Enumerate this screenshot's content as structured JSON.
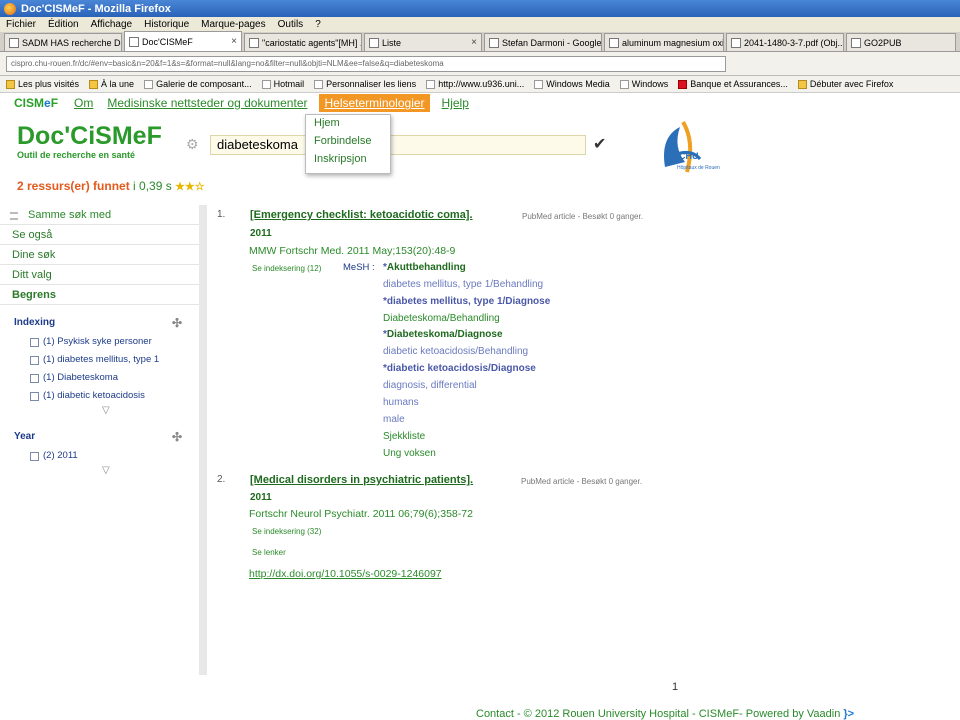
{
  "window": {
    "title": "Doc'CISMeF - Mozilla Firefox"
  },
  "menu": [
    "Fichier",
    "Édition",
    "Affichage",
    "Historique",
    "Marque-pages",
    "Outils",
    "?"
  ],
  "tabs": [
    {
      "label": "SADM HAS recherche Do...",
      "close": "×"
    },
    {
      "label": "Doc'CISMeF",
      "close": "×"
    },
    {
      "label": "\"cariostatic agents\"[MH] ...",
      "close": "×"
    },
    {
      "label": "Liste",
      "close": "×"
    },
    {
      "label": "Stefan Darmoni - Google ...",
      "close": "×"
    },
    {
      "label": "aluminum magnesium oxide",
      "close": "×"
    },
    {
      "label": "2041-1480-3-7.pdf (Obj...",
      "close": "×"
    },
    {
      "label": "GO2PUB",
      "close": ""
    }
  ],
  "url": "cispro.chu-rouen.fr/dc/#env=basic&n=20&f=1&s=&format=null&lang=no&filter=null&objti=NLM&ee=false&q=diabeteskoma",
  "bookmarks": [
    "Les plus visités",
    "À la une",
    "Galerie de composant...",
    "Hotmail",
    "Personnaliser les liens",
    "http://www.u936.uni...",
    "Windows Media",
    "Windows",
    "Banque et Assurances...",
    "Débuter avec Firefox"
  ],
  "nav": {
    "brand_a": "CISM",
    "brand_e": "e",
    "brand_b": "F",
    "items": [
      "Om",
      "Medisinske nettsteder og dokumenter",
      "Helseterminologier",
      "Hjelp"
    ],
    "dropdown": [
      "Hjem",
      "Forbindelse",
      "Inskripsjon"
    ]
  },
  "logo": {
    "title": "Doc'CiSMeF",
    "subtitle": "Outil de recherche en santé"
  },
  "chu": {
    "label": "CHU",
    "sub": "Hôpitaux de Rouen"
  },
  "search": {
    "value": "diabeteskoma",
    "submit": "✔"
  },
  "results_summary": {
    "count_text": "2 ressurs(er) funnet",
    "time_text": " i 0,39 s ",
    "stars": "★★☆"
  },
  "sidebar": {
    "sections": [
      "Samme søk med",
      "Se også",
      "Dine søk",
      "Ditt valg",
      "Begrens"
    ],
    "facets": [
      {
        "title": "Indexing",
        "items": [
          "(1) Psykisk syke personer",
          "(1) diabetes mellitus, type 1",
          "(1) Diabeteskoma",
          "(1) diabetic ketoacidosis"
        ]
      },
      {
        "title": "Year",
        "items": [
          "(2) 2011"
        ]
      }
    ],
    "move_icon": "✣",
    "more_icon": "▽"
  },
  "results": [
    {
      "num": "1.",
      "title": "[Emergency checklist: ketoacidotic coma].",
      "meta": "PubMed article - Besøkt 0 ganger.",
      "year": "2011",
      "source": "MMW Fortschr Med. 2011 May;153(20):48-9",
      "indexing_link": "Se indeksering (12)",
      "mesh_label": "MeSH :",
      "mesh_terms": [
        {
          "star": "*",
          "text": "Akuttbehandling"
        },
        {
          "star": "",
          "text": "diabetes mellitus, type 1/Behandling"
        },
        {
          "star": "*",
          "text": "diabetes mellitus, type 1/Diagnose"
        },
        {
          "star": "",
          "text": "Diabeteskoma/Behandling"
        },
        {
          "star": "*",
          "text": "Diabeteskoma/Diagnose"
        },
        {
          "star": "",
          "text": "diabetic ketoacidosis/Behandling"
        },
        {
          "star": "*",
          "text": "diabetic ketoacidosis/Diagnose"
        },
        {
          "star": "",
          "text": "diagnosis, differential"
        },
        {
          "star": "",
          "text": "humans"
        },
        {
          "star": "",
          "text": "male"
        },
        {
          "star": "",
          "text": "Sjekkliste"
        },
        {
          "star": "",
          "text": "Ung voksen"
        }
      ]
    },
    {
      "num": "2.",
      "title": "[Medical disorders in psychiatric patients].",
      "meta": "PubMed article - Besøkt 0 ganger.",
      "year": "2011",
      "source": "Fortschr Neurol Psychiatr. 2011 06;79(6);358-72",
      "indexing_link": "Se indeksering (32)",
      "links_label": "Se lenker",
      "doi": "http://dx.doi.org/10.1055/s-0029-1246097"
    }
  ],
  "pager": "1",
  "footer": {
    "text": "Contact - © 2012 Rouen University Hospital - CISMeF- Powered by Vaadin",
    "vaadin_mark": "}>"
  }
}
